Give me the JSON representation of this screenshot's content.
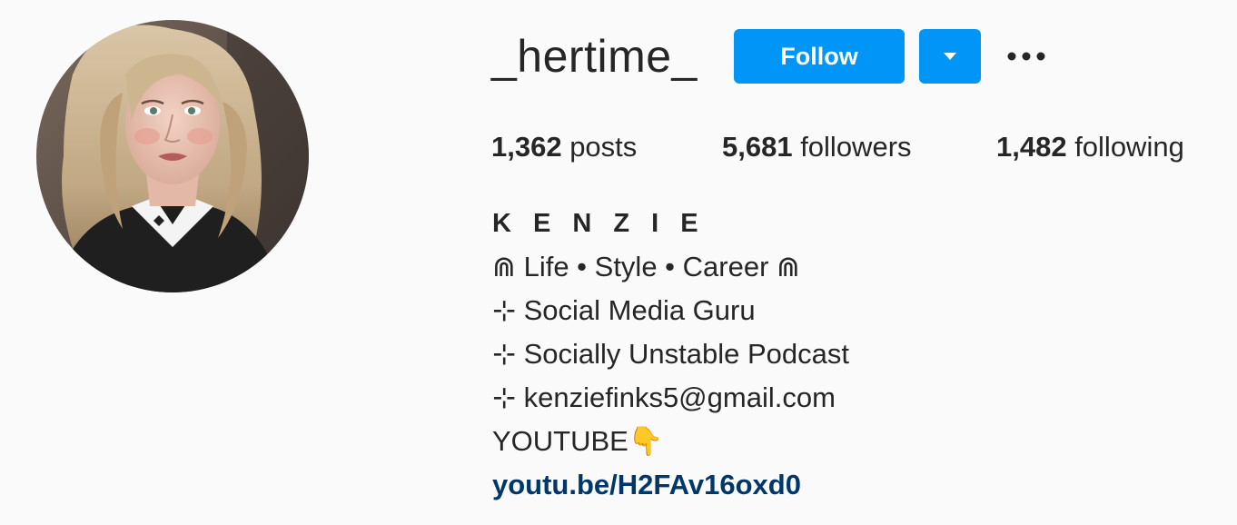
{
  "profile": {
    "username": "_hertime_",
    "avatar_alt": "profile-photo"
  },
  "actions": {
    "follow_label": "Follow",
    "dropdown_icon": "chevron-down-icon",
    "more_icon": "more-dots-icon",
    "accent_color": "#0095f6"
  },
  "stats": {
    "posts_count": "1,362",
    "posts_label": " posts",
    "followers_count": "5,681",
    "followers_label": " followers",
    "following_count": "1,482",
    "following_label": " following"
  },
  "bio": {
    "name": "K E N Z I E",
    "lines": [
      "⋒ Life • Style • Career ⋒",
      "⊹ Social Media Guru",
      "⊹ Socially Unstable Podcast",
      "⊹ kenziefinks5@gmail.com",
      "YOUTUBE👇"
    ],
    "link": "youtu.be/H2FAv16oxd0"
  }
}
